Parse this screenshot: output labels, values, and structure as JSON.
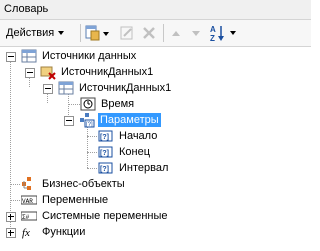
{
  "window": {
    "title": "Словарь"
  },
  "toolbar": {
    "actions_label": "Действия"
  },
  "tree": {
    "data_sources": "Источники данных",
    "source1": "ИсточникДанных1",
    "source1_inner": "ИсточникДанных1",
    "time": "Время",
    "parameters": "Параметры",
    "start": "Начало",
    "end": "Конец",
    "interval": "Интервал",
    "business_objects": "Бизнес-объекты",
    "variables": "Переменные",
    "system_variables": "Системные переменные",
    "functions": "Функции"
  },
  "colors": {
    "selection": "#3399ff"
  }
}
